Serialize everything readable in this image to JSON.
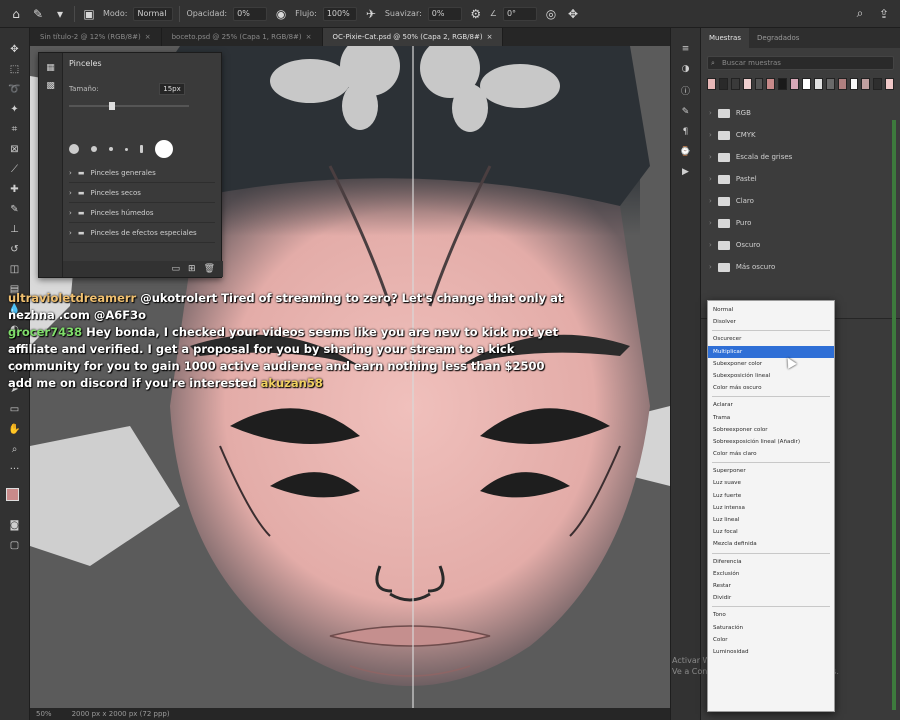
{
  "options_bar": {
    "brush_mode_label": "Modo:",
    "brush_mode_value": "Normal",
    "opacity_label": "Opacidad:",
    "opacity_value": "0%",
    "flow_label": "Flujo:",
    "flow_value": "100%",
    "smoothing_label": "Suavizar:",
    "smoothing_value": "0%",
    "angle_value": "0°"
  },
  "document_tabs": [
    {
      "label": "Sin título-2 @ 12% (RGB/8#)",
      "active": false
    },
    {
      "label": "boceto.psd @ 25% (Capa 1, RGB/8#)",
      "active": false
    },
    {
      "label": "OC-Pixie-Cat.psd @ 50% (Capa 2, RGB/8#)",
      "active": true
    }
  ],
  "brush_panel": {
    "title": "Pinceles",
    "size_label": "Tamaño:",
    "size_value": "15px",
    "folders": [
      "Pinceles generales",
      "Pinceles secos",
      "Pinceles húmedos",
      "Pinceles de efectos especiales"
    ]
  },
  "chat": [
    {
      "user": "ultravioletdreamerr",
      "text": "@ukotrolert Tired of streaming to zero? Let's change that only at nezhna .com @A6F3o"
    },
    {
      "user": "grocer7438",
      "text": "Hey bonda, I checked your videos seems like you are new to kick not yet affiliate and verified. I get a proposal for you by sharing your stream to a kick community for you to gain 1000 active audience and earn nothing less than $2500 add me on discord if you're interested"
    },
    {
      "user": "akuzan58",
      "text": ""
    }
  ],
  "right_panel": {
    "tabs": [
      "Muestras",
      "Degradados"
    ],
    "search_placeholder": "Buscar muestras",
    "swatch_colors": [
      "#e8b8b8",
      "#2a2a2a",
      "#3a3a3a",
      "#f0d0d0",
      "#555555",
      "#c88a8a",
      "#1a1a1a",
      "#d8a8b8",
      "#ffffff",
      "#e0e0e0",
      "#6a6a6a",
      "#b08080",
      "#f8f8f8",
      "#c0a0a0",
      "#2e2e2e",
      "#f0c8c8"
    ],
    "folders": [
      "RGB",
      "CMYK",
      "Escala de grises",
      "Pastel",
      "Claro",
      "Puro",
      "Oscuro",
      "Más oscuro"
    ]
  },
  "blend_dropdown": {
    "items": [
      [
        "Normal",
        "Disolver"
      ],
      [
        "Oscurecer",
        "Multiplicar",
        "Subexponer color",
        "Subexposición lineal",
        "Color más oscuro"
      ],
      [
        "Aclarar",
        "Trama",
        "Sobreexponer color",
        "Sobreexposición lineal (Añadir)",
        "Color más claro"
      ],
      [
        "Superponer",
        "Luz suave",
        "Luz fuerte",
        "Luz intensa",
        "Luz lineal",
        "Luz focal",
        "Mezcla definida"
      ],
      [
        "Diferencia",
        "Exclusión",
        "Restar",
        "Dividir"
      ],
      [
        "Tono",
        "Saturación",
        "Color",
        "Luminosidad"
      ]
    ],
    "selected": "Multiplicar"
  },
  "watermark": [
    "Activar Windows",
    "Ve a Configuración para activar Windows."
  ],
  "status_bar": {
    "zoom": "50%",
    "doc_info": "2000 px x 2000 px (72 ppp)"
  },
  "colors": {
    "skin": "#e8b4b0",
    "hair": "#2c3136",
    "ui_bg": "#323232",
    "accent": "#2f6fd6"
  }
}
